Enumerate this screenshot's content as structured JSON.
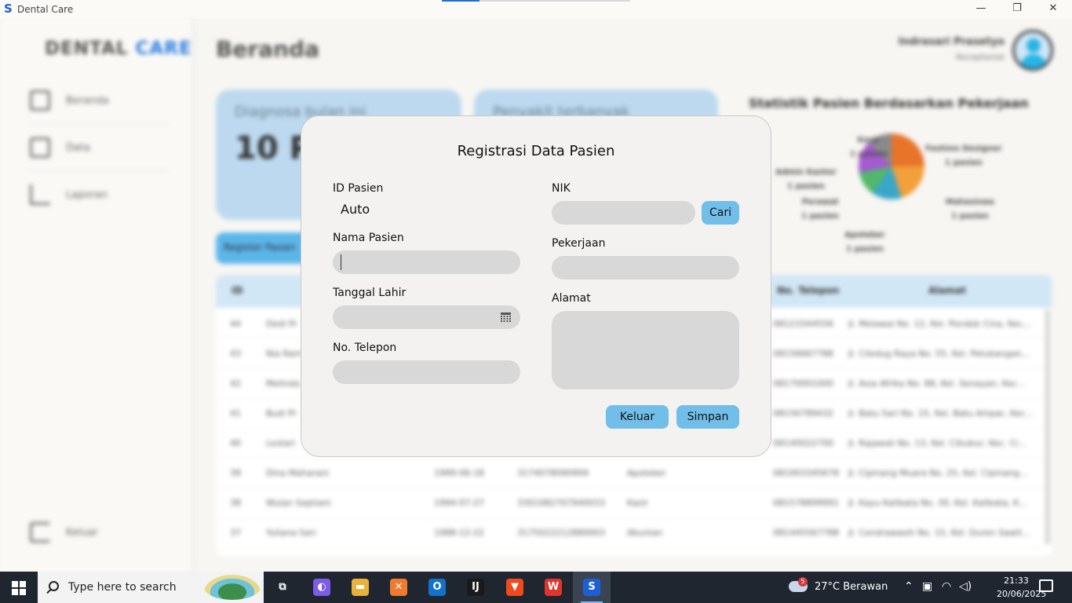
{
  "window": {
    "title": "Dental Care",
    "icon": "S",
    "minimize_glyph": "—",
    "maximize_glyph": "❐",
    "close_glyph": "✕"
  },
  "background_app": {
    "brand_part1": "DENTAL",
    "brand_part2": "CARE",
    "sidebar_items": [
      {
        "label": "Beranda",
        "icon": "dashboard-icon"
      },
      {
        "label": "Data",
        "icon": "data-icon"
      },
      {
        "label": "Laporan",
        "icon": "chart-icon"
      }
    ],
    "logout_label": "Keluar",
    "page_title": "Beranda",
    "user_name": "Indrasari Prasetyo",
    "user_role": "Receptionist",
    "card1_label": "Diagnosa bulan ini",
    "card1_value": "10 Pa",
    "card2_label": "Penyakit terbanyak",
    "register_button": "Register Pasien",
    "stat_title": "Statistik Pasien Berdasarkan Pekerjaan",
    "pie_labels": [
      "Kasir\n1 pasien",
      "Fashion Designer\n1 pasien",
      "Admin Kantor\n1 pasien",
      "Perawat\n1 pasien",
      "Mahasiswa\n1 pasien",
      "Apoteker\n1 pasien"
    ],
    "table_headers": [
      "ID",
      "No. Telepon",
      "Alamat"
    ],
    "table_rows": [
      [
        "44",
        "Dedi Pr",
        "",
        "",
        "",
        "08123344556",
        "Jl. Melawai No. 12, Kel. Pondok Cina, Kec..."
      ],
      [
        "43",
        "Nia Ram",
        "",
        "",
        "",
        "08156667788",
        "Jl. Ciledug Raya No. 55, Kel. Petukangan..."
      ],
      [
        "42",
        "Melinda",
        "",
        "",
        "",
        "08170001000",
        "Jl. Asia Afrika No. 88, Kel. Senayan, Kec..."
      ],
      [
        "41",
        "Budi Pr",
        "",
        "",
        "",
        "08156789432",
        "Jl. Batu Sari No. 15, Kel. Batu Ampar, Kec..."
      ],
      [
        "40",
        "Lestari",
        "",
        "",
        "",
        "08140022700",
        "Jl. Rajawali No. 13, Kel. Cibubur, Kec. Ci..."
      ],
      [
        "39",
        "Dina Maharani",
        "1999-06-18",
        "3174078090909",
        "Apoteker",
        "081003345678",
        "Jl. Cipinang Muara No. 25, Kel. Cipinang..."
      ],
      [
        "38",
        "Wulan Septiani",
        "1994-07-27",
        "3301082707940033",
        "Kasir",
        "081578899991",
        "Jl. Kayu Kalibata No. 30, Kel. Kalibata, K..."
      ],
      [
        "37",
        "Yuliana Sari",
        "1988-12-22",
        "3175022212880003",
        "Akuntan",
        "081445567788",
        "Jl. Cendrawasih No. 15, Kel. Duren Sawit..."
      ]
    ]
  },
  "dialog": {
    "title": "Registrasi Data Pasien",
    "id_label": "ID Pasien",
    "id_value": "Auto",
    "nama_label": "Nama Pasien",
    "nama_value": "",
    "tanggal_label": "Tanggal Lahir",
    "tanggal_value": "",
    "telepon_label": "No. Telepon",
    "telepon_value": "",
    "nik_label": "NIK",
    "nik_value": "",
    "cari_button": "Cari",
    "pekerjaan_label": "Pekerjaan",
    "pekerjaan_value": "",
    "alamat_label": "Alamat",
    "alamat_value": "",
    "keluar_button": "Keluar",
    "simpan_button": "Simpan"
  },
  "taskbar": {
    "search_placeholder": "Type here to search",
    "apps": [
      {
        "name": "task-view-icon",
        "glyph": "⧉",
        "color": "#1f2630"
      },
      {
        "name": "copilot-icon",
        "glyph": "◐",
        "color": "#7c5ce8"
      },
      {
        "name": "file-explorer-icon",
        "glyph": "▬",
        "color": "#e8b33a"
      },
      {
        "name": "xampp-icon",
        "glyph": "✕",
        "color": "#f07a2d"
      },
      {
        "name": "outlook-icon",
        "glyph": "O",
        "color": "#1271c9"
      },
      {
        "name": "intellij-icon",
        "glyph": "IJ",
        "color": "#1a1a1a"
      },
      {
        "name": "brave-icon",
        "glyph": "▼",
        "color": "#f04b1c"
      },
      {
        "name": "wps-icon",
        "glyph": "W",
        "color": "#e0352b"
      },
      {
        "name": "dental-care-app-icon",
        "glyph": "S",
        "color": "#1f5fd6"
      }
    ],
    "weather_badge": "5",
    "weather_text": "27°C  Berawan",
    "time": "21:33",
    "date": "20/06/2025"
  }
}
